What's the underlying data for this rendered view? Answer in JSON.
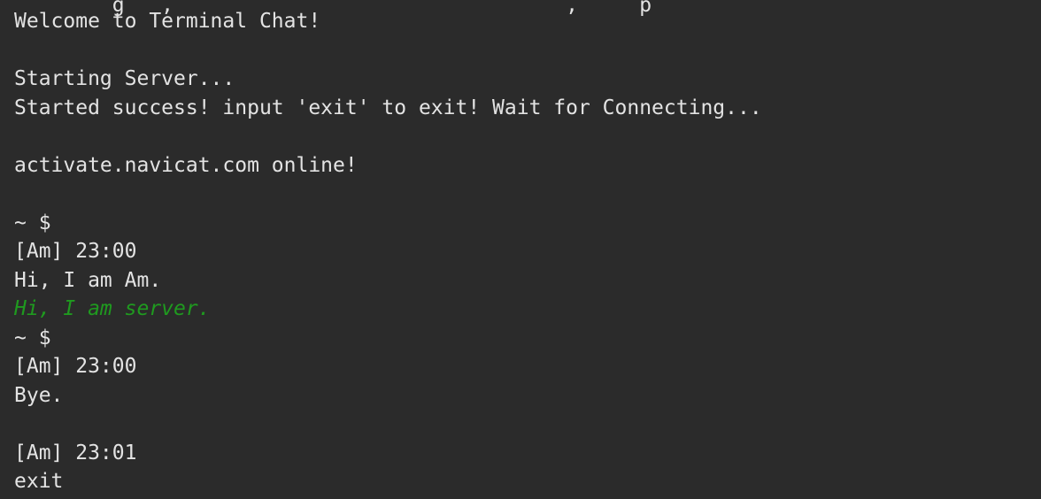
{
  "terminal": {
    "lines": [
      {
        "id": "clipped-top",
        "text": "        g   ,                                ,     p    "
      },
      {
        "id": "welcome",
        "text": "Welcome to Terminal Chat!"
      },
      {
        "id": "blank1",
        "text": ""
      },
      {
        "id": "starting",
        "text": "Starting Server..."
      },
      {
        "id": "started",
        "text": "Started success! input 'exit' to exit! Wait for Connecting..."
      },
      {
        "id": "blank2",
        "text": ""
      },
      {
        "id": "online",
        "text": "activate.navicat.com online!"
      },
      {
        "id": "blank3",
        "text": ""
      },
      {
        "id": "prompt1",
        "text": "~ $"
      },
      {
        "id": "header1",
        "text": "[Am] 23:00"
      },
      {
        "id": "msg1",
        "text": "Hi, I am Am."
      },
      {
        "id": "server-msg",
        "text": "Hi, I am server."
      },
      {
        "id": "prompt2",
        "text": "~ $"
      },
      {
        "id": "header2",
        "text": "[Am] 23:00"
      },
      {
        "id": "msg2",
        "text": "Bye."
      },
      {
        "id": "blank4",
        "text": ""
      },
      {
        "id": "header3",
        "text": "[Am] 23:01"
      },
      {
        "id": "msg3",
        "text": "exit"
      }
    ],
    "colors": {
      "background": "#2b2b2b",
      "text": "#e3e3e3",
      "server_message": "#1f9a1f"
    }
  }
}
